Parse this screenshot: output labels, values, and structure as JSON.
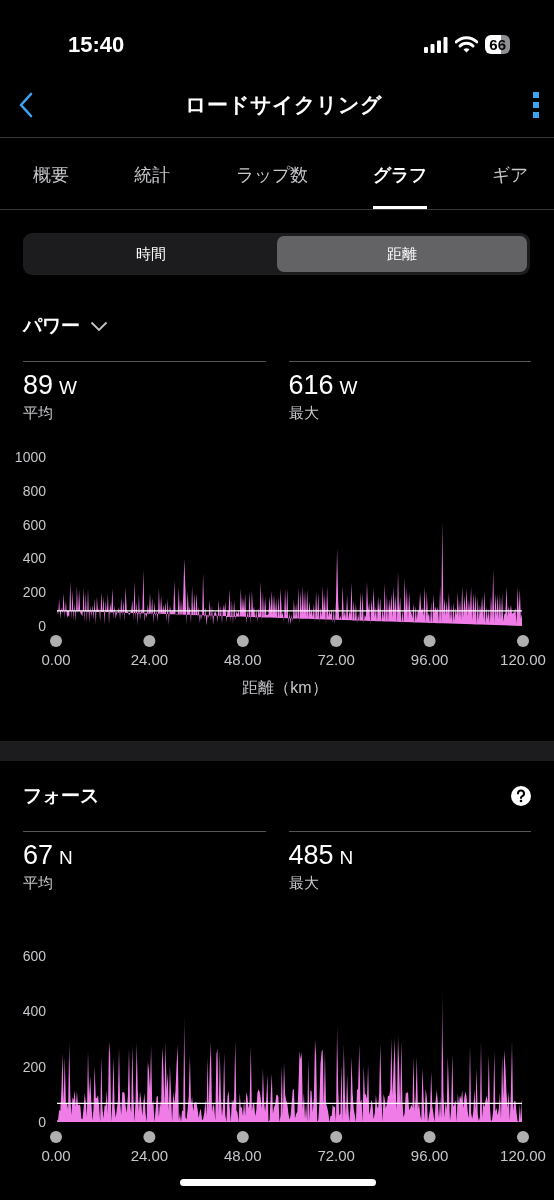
{
  "status_bar": {
    "time": "15:40",
    "battery": "66"
  },
  "header": {
    "title": "ロードサイクリング"
  },
  "tabs": [
    {
      "label": "概要",
      "selected": false
    },
    {
      "label": "統計",
      "selected": false
    },
    {
      "label": "ラップ数",
      "selected": false
    },
    {
      "label": "グラフ",
      "selected": true
    },
    {
      "label": "ギア",
      "selected": false
    }
  ],
  "segmented": [
    {
      "label": "時間",
      "selected": false
    },
    {
      "label": "距離",
      "selected": true
    }
  ],
  "sections": [
    {
      "title": "パワー",
      "dropdown": true,
      "help": false,
      "stats": [
        {
          "value": "89",
          "unit": "W",
          "label": "平均"
        },
        {
          "value": "616",
          "unit": "W",
          "label": "最大"
        }
      ],
      "y_ticks": [
        "1000",
        "800",
        "600",
        "400",
        "200",
        "0"
      ],
      "x_ticks": [
        "0.00",
        "24.00",
        "48.00",
        "72.00",
        "96.00",
        "120.00"
      ],
      "xlabel": "距離（km）"
    },
    {
      "title": "フォース",
      "dropdown": false,
      "help": true,
      "stats": [
        {
          "value": "67",
          "unit": "N",
          "label": "平均"
        },
        {
          "value": "485",
          "unit": "N",
          "label": "最大"
        }
      ],
      "y_ticks": [
        "600",
        "400",
        "200",
        "0"
      ],
      "x_ticks": [
        "0.00",
        "24.00",
        "48.00",
        "72.00",
        "96.00",
        "120.00"
      ]
    }
  ]
}
